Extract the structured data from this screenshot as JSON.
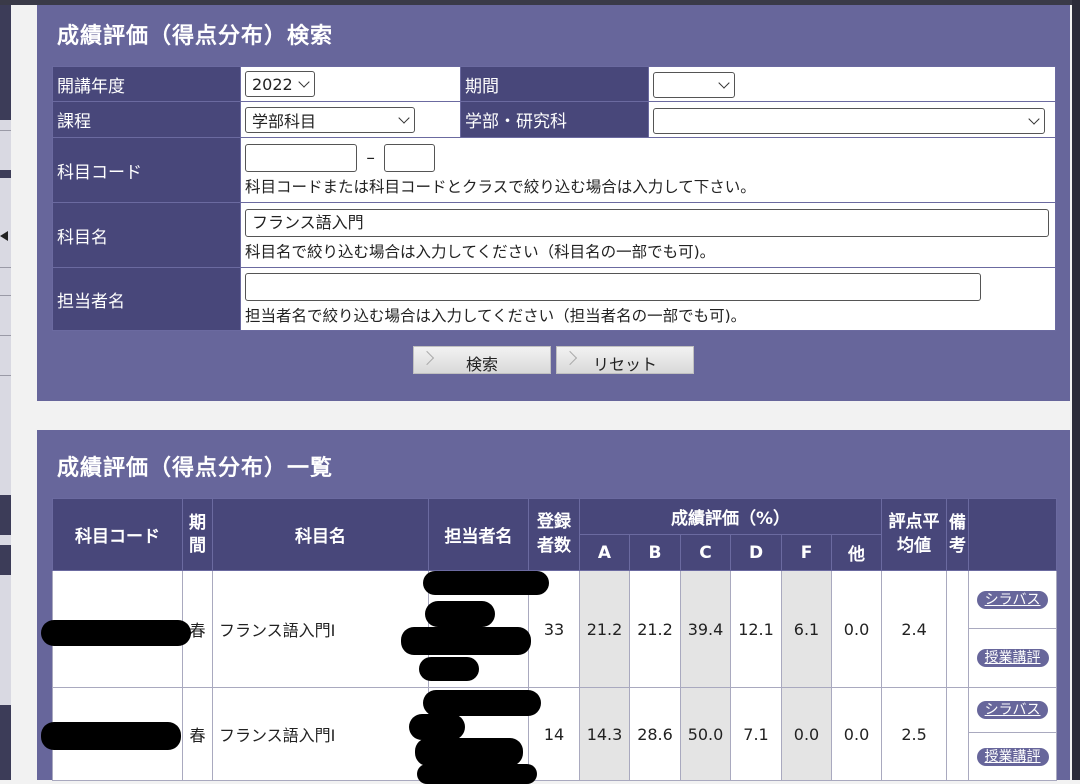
{
  "search": {
    "title": "成績評価（得点分布）検索",
    "year_label": "開講年度",
    "year_value": "2022",
    "period_label": "期間",
    "period_value": "",
    "course_label": "課程",
    "course_value": "学部科目",
    "faculty_label": "学部・研究科",
    "faculty_value": "",
    "code_label": "科目コード",
    "code_dash": "–",
    "code_note": "科目コードまたは科目コードとクラスで絞り込む場合は入力して下さい。",
    "subject_label": "科目名",
    "subject_value": "フランス語入門",
    "subject_note": "科目名で絞り込む場合は入力してください（科目名の一部でも可)。",
    "teacher_label": "担当者名",
    "teacher_value": "",
    "teacher_note": "担当者名で絞り込む場合は入力してください（担当者名の一部でも可)。",
    "search_button": "検索",
    "reset_button": "リセット"
  },
  "results": {
    "title": "成績評価（得点分布）一覧",
    "headers": {
      "code": "科目コード",
      "period": "期間",
      "subject": "科目名",
      "teacher": "担当者名",
      "enrolled": "登録者数",
      "grade": "成績評価（%）",
      "a": "A",
      "b": "B",
      "c": "C",
      "d": "D",
      "f": "F",
      "other": "他",
      "avg": "評点平均値",
      "note": "備考"
    },
    "rows": [
      {
        "period": "春",
        "subject": "フランス語入門I",
        "enrolled": "33",
        "a": "21.2",
        "b": "21.2",
        "c": "39.4",
        "d": "12.1",
        "f": "6.1",
        "other": "0.0",
        "avg": "2.4",
        "syllabus": "シラバス",
        "review": "授業講評"
      },
      {
        "period": "春",
        "subject": "フランス語入門I",
        "enrolled": "14",
        "a": "14.3",
        "b": "28.6",
        "c": "50.0",
        "d": "7.1",
        "f": "0.0",
        "other": "0.0",
        "avg": "2.5",
        "syllabus": "シラバス",
        "review": "授業講評"
      }
    ]
  }
}
